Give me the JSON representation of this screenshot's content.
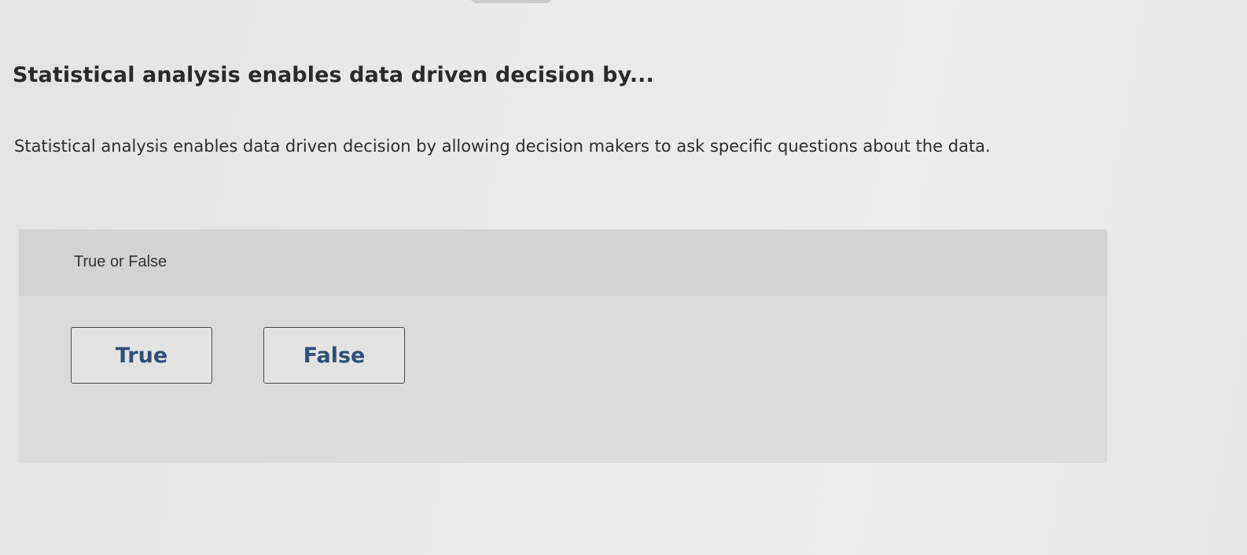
{
  "question": {
    "title": "Statistical analysis enables data driven decision by...",
    "prompt": "Statistical analysis enables data driven decision by allowing decision makers to ask specific questions about the data."
  },
  "answer_panel": {
    "type_label": "True or False",
    "choices": [
      {
        "label": "True"
      },
      {
        "label": "False"
      }
    ]
  },
  "colors": {
    "page_background": "#e9e9e8",
    "panel_background": "#dbdbda",
    "panel_header": "#d3d3d2",
    "choice_text": "#2f4f7a",
    "choice_border": "#4a4a4a"
  }
}
